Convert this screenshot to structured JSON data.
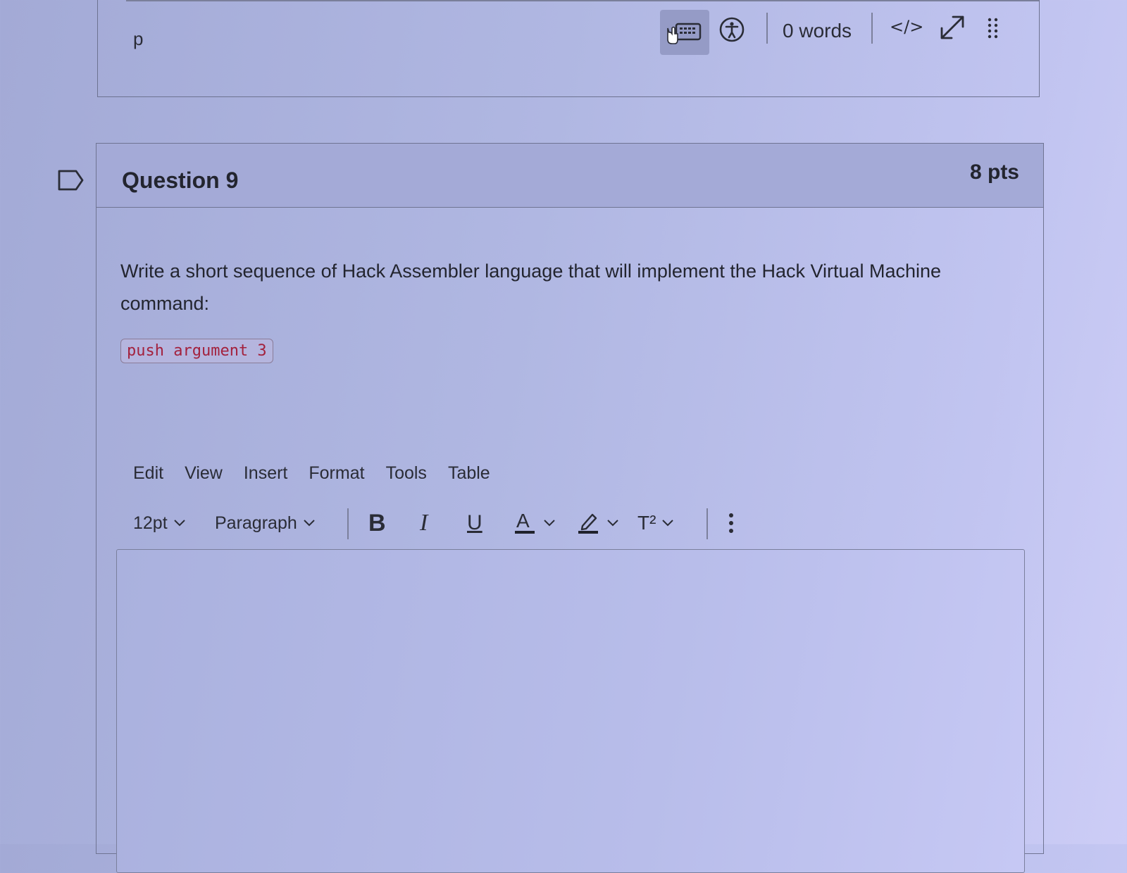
{
  "previous_editor": {
    "status_path": "p",
    "word_count": "0 words",
    "code_view_label": "</>"
  },
  "question": {
    "title": "Question 9",
    "points": "8 pts",
    "text": "Write a short sequence of Hack Assembler language that will implement the Hack Virtual Machine command:",
    "code": "push argument 3"
  },
  "editor": {
    "menu": [
      "Edit",
      "View",
      "Insert",
      "Format",
      "Tools",
      "Table"
    ],
    "font_size": "12pt",
    "block_format": "Paragraph",
    "bold_label": "B",
    "italic_label": "I",
    "underline_label": "U",
    "text_color_label": "A",
    "superscript_label": "T²",
    "content": ""
  },
  "colors": {
    "code_text": "#a3213d",
    "text": "#23252f"
  }
}
